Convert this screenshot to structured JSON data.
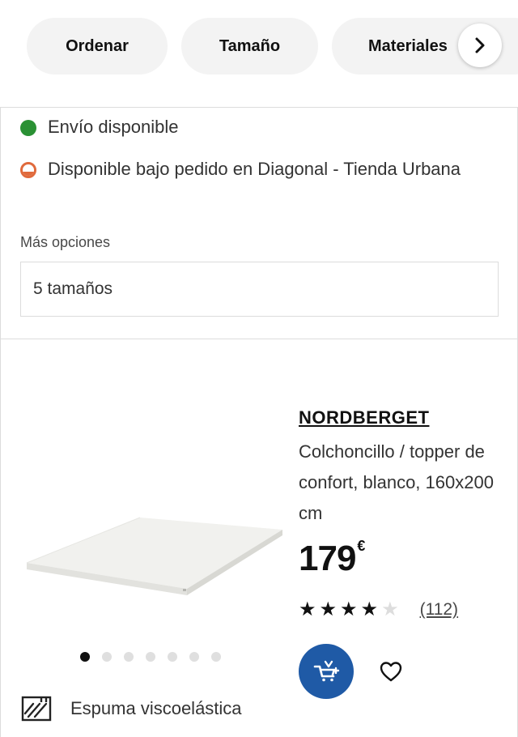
{
  "filters": {
    "chips": [
      "Ordenar",
      "Tamaño",
      "Materiales"
    ],
    "more_icon": "chevron-right-icon"
  },
  "previous_product": {
    "availability_shipping": "Envío disponible",
    "availability_store": "Disponible bajo pedido en Diagonal - Tienda Urbana",
    "more_options_label": "Más opciones",
    "sizes_option": "5 tamaños"
  },
  "product": {
    "name": "NORDBERGET",
    "description": "Colchoncillo / topper de confort, blanco, 160x200 cm",
    "price": "179",
    "currency": "€",
    "rating": 4,
    "rating_max": 5,
    "reviews_count": "(112)",
    "image_count": 7,
    "active_image": 1,
    "feature_label": "Espuma viscoelástica",
    "icons": [
      "add-to-cart-icon",
      "heart-icon",
      "memory-foam-icon"
    ]
  },
  "colors": {
    "available": "#2a9134",
    "on_order": "#e06a3c",
    "cart_button": "#1f5aa6"
  }
}
